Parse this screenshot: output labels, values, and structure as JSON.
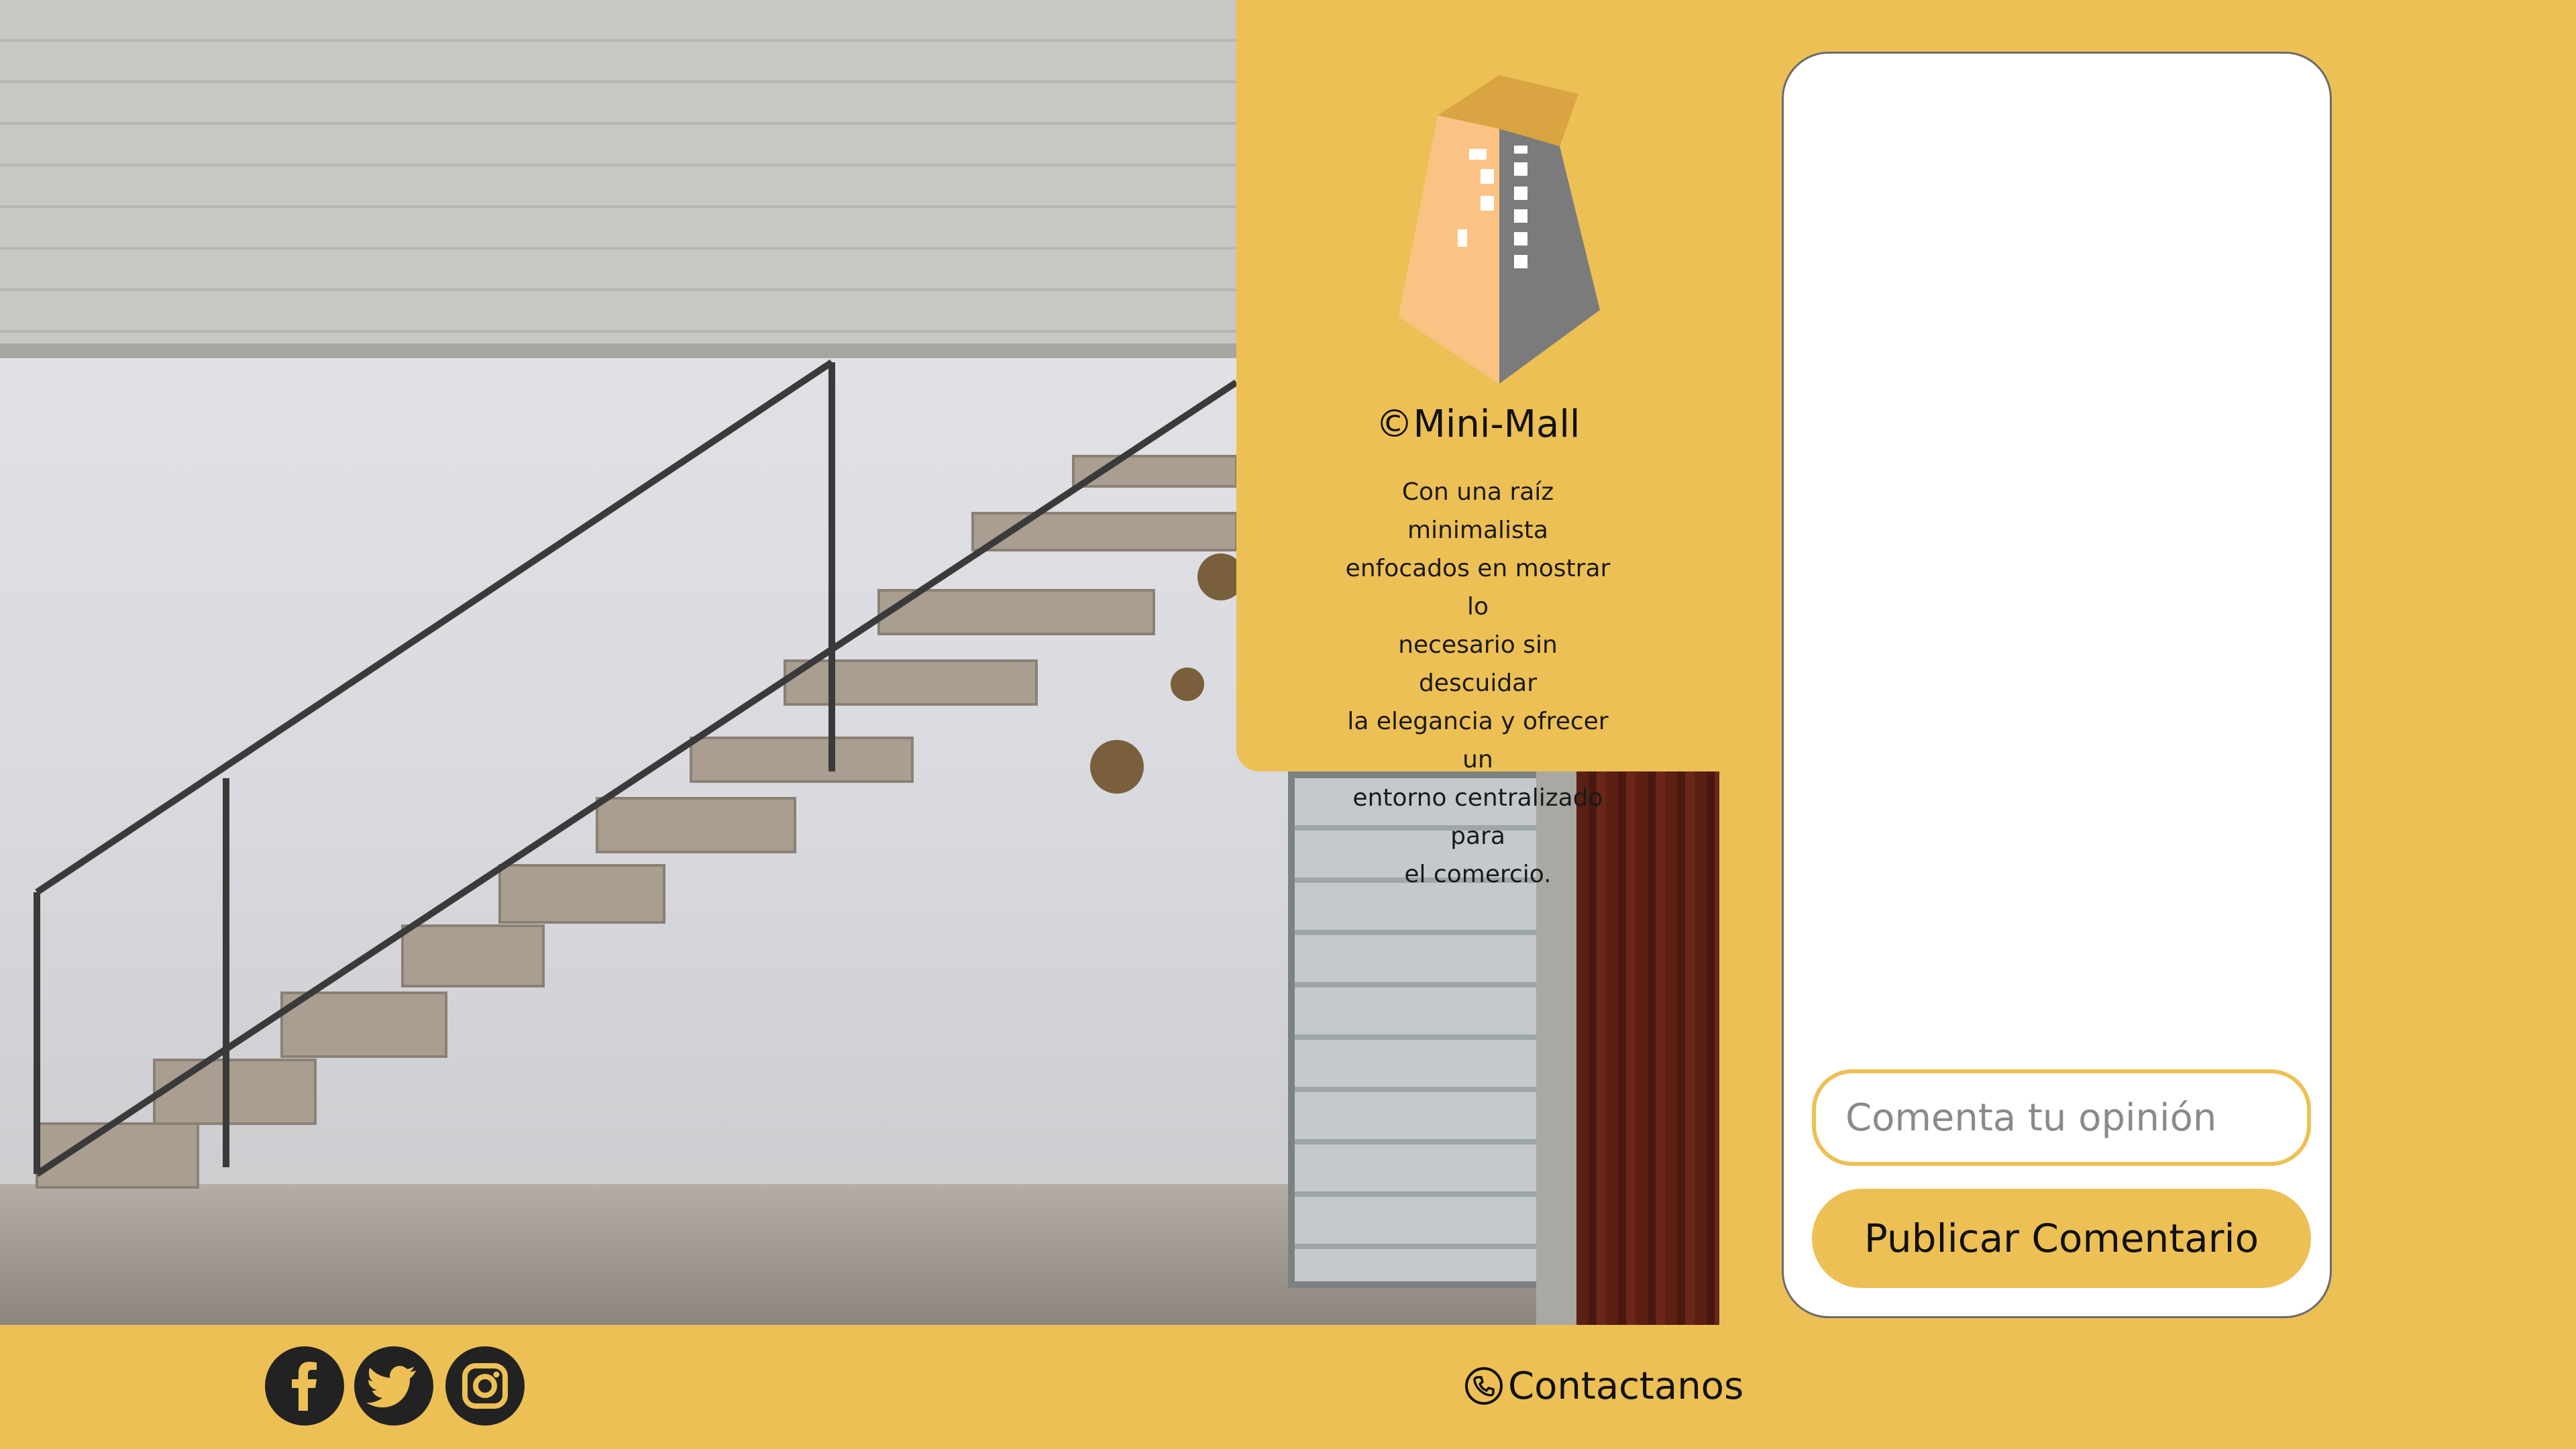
{
  "brand": {
    "name": "©Mini-Mall",
    "description": "Con una raíz minimalista\nenfocados en mostrar lo\nnecesario sin descuidar\n la elegancia y ofrecer un\nentorno centralizado para\nel comercio."
  },
  "comments": {
    "input_placeholder": "Comenta tu opinión",
    "publish_label": "Publicar Comentario"
  },
  "footer": {
    "social": [
      "facebook-icon",
      "twitter-icon",
      "instagram-icon"
    ],
    "contact_label": "Contactanos",
    "contact_icon": "phone-icon"
  },
  "colors": {
    "accent": "#EDC055",
    "card": "#FFFFFF",
    "icon": "#222222"
  }
}
